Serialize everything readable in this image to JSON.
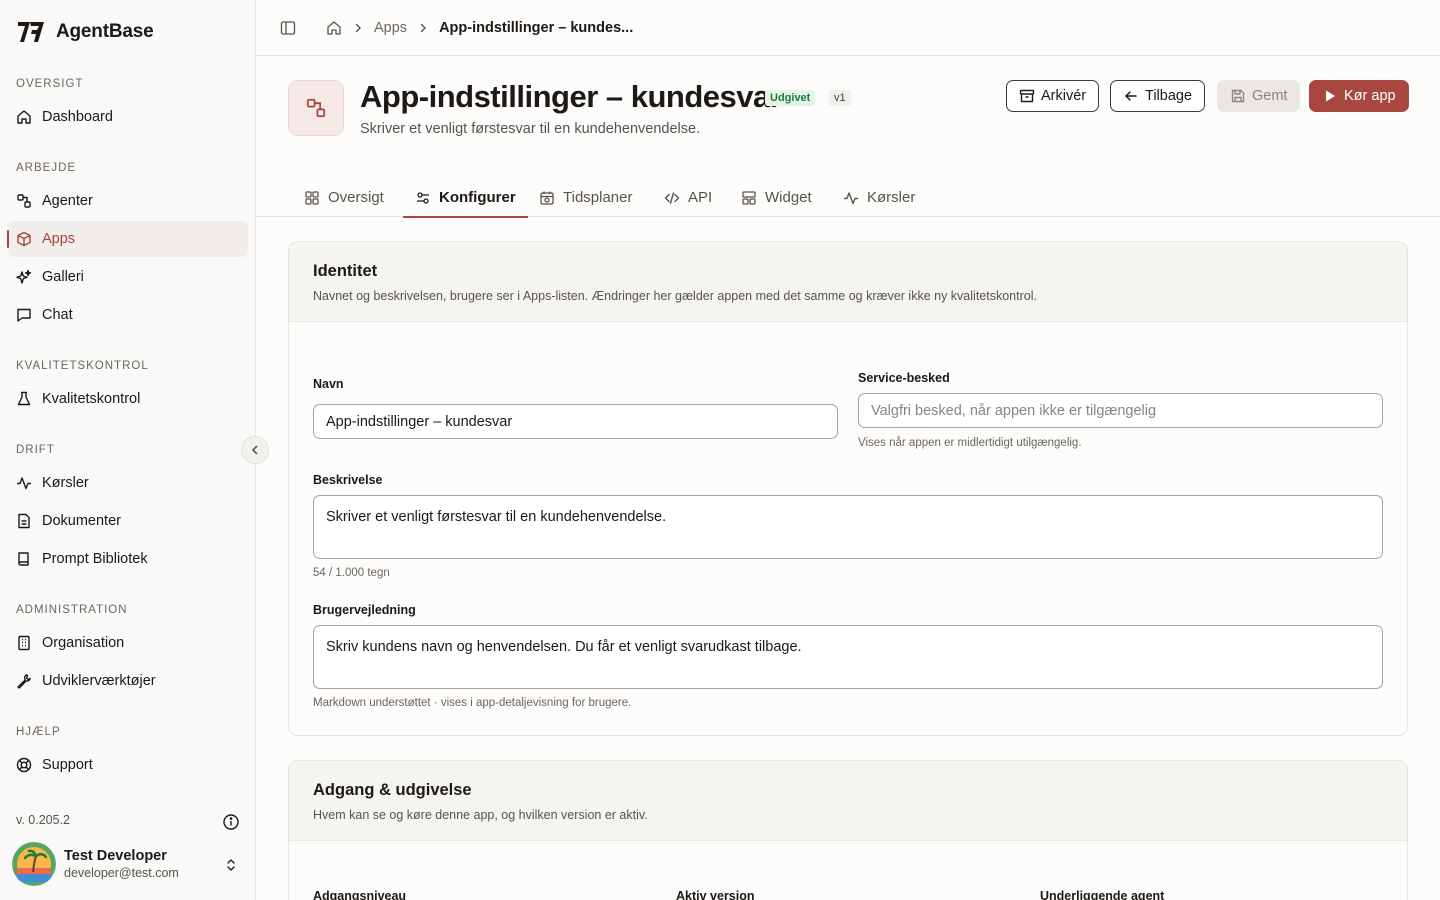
{
  "brand": {
    "name": "AgentBase"
  },
  "sidebar": {
    "sections": [
      {
        "heading": "OVERSIGT",
        "items": [
          {
            "label": "Dashboard",
            "icon": "home-icon"
          }
        ]
      },
      {
        "heading": "ARBEJDE",
        "items": [
          {
            "label": "Agenter",
            "icon": "workflow-icon"
          },
          {
            "label": "Apps",
            "icon": "cube-icon",
            "active": true
          },
          {
            "label": "Galleri",
            "icon": "sparkles-icon"
          },
          {
            "label": "Chat",
            "icon": "chat-icon"
          }
        ]
      },
      {
        "heading": "KVALITETSKONTROL",
        "items": [
          {
            "label": "Kvalitetskontrol",
            "icon": "flask-icon"
          }
        ]
      },
      {
        "heading": "DRIFT",
        "items": [
          {
            "label": "Kørsler",
            "icon": "activity-icon"
          },
          {
            "label": "Dokumenter",
            "icon": "document-icon"
          },
          {
            "label": "Prompt Bibliotek",
            "icon": "book-icon"
          }
        ]
      },
      {
        "heading": "ADMINISTRATION",
        "items": [
          {
            "label": "Organisation",
            "icon": "building-icon"
          },
          {
            "label": "Udviklerværktøjer",
            "icon": "wrench-icon"
          }
        ]
      },
      {
        "heading": "HJÆLP",
        "items": [
          {
            "label": "Support",
            "icon": "lifebuoy-icon"
          }
        ]
      }
    ],
    "version": "v. 0.205.2",
    "user": {
      "name": "Test Developer",
      "email": "developer@test.com"
    }
  },
  "breadcrumb": {
    "items": [
      "Apps"
    ],
    "current": "App-indstillinger – kundes..."
  },
  "header": {
    "title": "App-indstillinger – kundesvar",
    "status": "Udgivet",
    "version": "v1",
    "subtitle": "Skriver et venligt førstesvar til en kundehenvendelse.",
    "buttons": {
      "archive": "Arkivér",
      "back": "Tilbage",
      "saved": "Gemt",
      "run": "Kør app"
    }
  },
  "tabs": [
    {
      "label": "Oversigt",
      "icon": "grid-icon"
    },
    {
      "label": "Konfigurer",
      "icon": "sliders-icon",
      "active": true
    },
    {
      "label": "Tidsplaner",
      "icon": "calendar-icon"
    },
    {
      "label": "API",
      "icon": "code-icon"
    },
    {
      "label": "Widget",
      "icon": "layout-icon"
    },
    {
      "label": "Kørsler",
      "icon": "activity-icon"
    }
  ],
  "identity": {
    "title": "Identitet",
    "description": "Navnet og beskrivelsen, brugere ser i Apps-listen. Ændringer her gælder appen med det samme og kræver ikke ny kvalitetskontrol.",
    "name_label": "Navn",
    "name_value": "App-indstillinger – kundesvar",
    "service_label": "Service-besked",
    "service_placeholder": "Valgfri besked, når appen ikke er tilgængelig",
    "service_hint": "Vises når appen er midlertidigt utilgængelig.",
    "description_label": "Beskrivelse",
    "description_value": "Skriver et venligt førstesvar til en kundehenvendelse.",
    "description_count": "54 / 1.000 tegn",
    "guide_label": "Brugervejledning",
    "guide_value": "Skriv kundens navn og henvendelsen. Du får et venligt svarudkast tilbage.",
    "guide_hint": "Markdown understøttet · vises i app-detaljevisning for brugere."
  },
  "access": {
    "title": "Adgang & udgivelse",
    "description": "Hvem kan se og køre denne app, og hvilken version er aktiv.",
    "level_label": "Adgangsniveau",
    "version_label": "Aktiv version",
    "agent_label": "Underliggende agent"
  },
  "colors": {
    "accent": "#a84640",
    "accent_bg": "#f5e9e7",
    "published": "#1f7a3f"
  }
}
